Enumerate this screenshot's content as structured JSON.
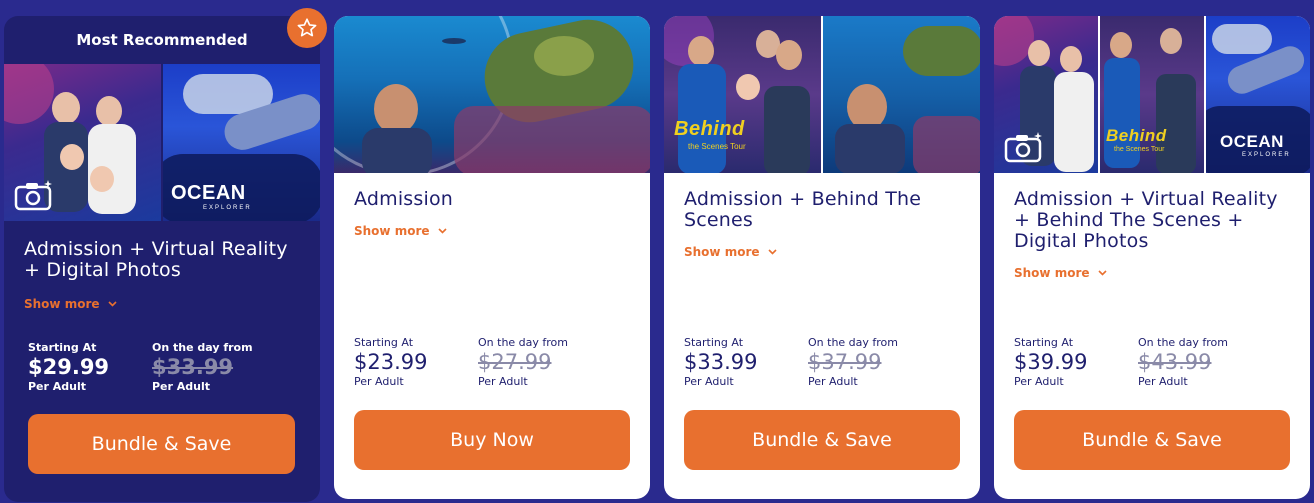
{
  "cards": [
    {
      "badge": "Most Recommended",
      "title": "Admission + Virtual Reality + Digital Photos",
      "show_more": "Show more",
      "starting_label": "Starting At",
      "starting_price": "$29.99",
      "starting_per": "Per Adult",
      "day_label": "On the day from",
      "day_price": "$33.99",
      "day_per": "Per Adult",
      "cta": "Bundle & Save",
      "images": [
        "family-photo-image",
        "vr-ocean-explorer-image"
      ],
      "brand": "OCEAN",
      "brand_sub": "EXPLORER"
    },
    {
      "title": "Admission",
      "show_more": "Show more",
      "starting_label": "Starting At",
      "starting_price": "$23.99",
      "starting_per": "Per Adult",
      "day_label": "On the day from",
      "day_price": "$27.99",
      "day_per": "Per Adult",
      "cta": "Buy Now",
      "images": [
        "turtle-tunnel-image"
      ]
    },
    {
      "title": "Admission + Behind The Scenes",
      "show_more": "Show more",
      "starting_label": "Starting At",
      "starting_price": "$33.99",
      "starting_per": "Per Adult",
      "day_label": "On the day from",
      "day_price": "$37.99",
      "day_per": "Per Adult",
      "cta": "Bundle & Save",
      "images": [
        "behind-the-scenes-image",
        "kid-tunnel-image"
      ],
      "logo_main": "Behind",
      "logo_sub": "the Scenes Tour"
    },
    {
      "title": "Admission + Virtual Reality + Behind The Scenes + Digital Photos",
      "show_more": "Show more",
      "starting_label": "Starting At",
      "starting_price": "$39.99",
      "starting_per": "Per Adult",
      "day_label": "On the day from",
      "day_price": "$43.99",
      "day_per": "Per Adult",
      "cta": "Bundle & Save",
      "images": [
        "family-photo-image",
        "behind-the-scenes-image",
        "vr-ocean-explorer-image"
      ],
      "brand": "OCEAN",
      "brand_sub": "EXPLORER",
      "logo_main": "Behind",
      "logo_sub": "the Scenes Tour"
    }
  ],
  "colors": {
    "page_bg": "#2a2a8e",
    "featured_bg": "#1f1f6e",
    "accent": "#e8702f",
    "navy_text": "#1f1f6e",
    "strike": "#8a8aa8"
  },
  "icons": [
    "star-icon",
    "camera-sparkle-icon",
    "chevron-down-icon"
  ]
}
